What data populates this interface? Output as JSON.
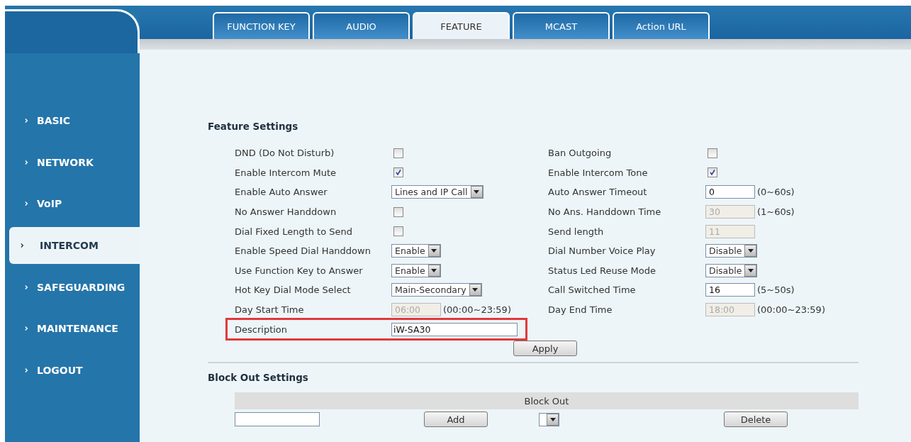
{
  "tabs": [
    {
      "label": "FUNCTION KEY",
      "selected": false
    },
    {
      "label": "AUDIO",
      "selected": false
    },
    {
      "label": "FEATURE",
      "selected": true
    },
    {
      "label": "MCAST",
      "selected": false
    },
    {
      "label": "Action URL",
      "selected": false
    }
  ],
  "sidebar": {
    "items": [
      {
        "label": "BASIC",
        "selected": false
      },
      {
        "label": "NETWORK",
        "selected": false
      },
      {
        "label": "VoIP",
        "selected": false
      },
      {
        "label": "INTERCOM",
        "selected": true
      },
      {
        "label": "SAFEGUARDING",
        "selected": false
      },
      {
        "label": "MAINTENANCE",
        "selected": false
      },
      {
        "label": "LOGOUT",
        "selected": false
      }
    ]
  },
  "feature_settings": {
    "title": "Feature Settings",
    "rows": [
      {
        "highlighted": false,
        "left": {
          "label": "DND (Do Not Disturb)",
          "kind": "checkbox",
          "checked": false
        },
        "right": {
          "label": "Ban Outgoing",
          "kind": "checkbox",
          "checked": false
        }
      },
      {
        "highlighted": false,
        "left": {
          "label": "Enable Intercom Mute",
          "kind": "checkbox",
          "checked": true
        },
        "right": {
          "label": "Enable Intercom Tone",
          "kind": "checkbox",
          "checked": true
        }
      },
      {
        "highlighted": false,
        "left": {
          "label": "Enable Auto Answer",
          "kind": "select",
          "value": "Lines and IP Call"
        },
        "right": {
          "label": "Auto Answer Timeout",
          "kind": "input",
          "value": "0",
          "disabled": false,
          "hint": "(0~60s)"
        }
      },
      {
        "highlighted": false,
        "left": {
          "label": "No Answer Handdown",
          "kind": "checkbox",
          "checked": false
        },
        "right": {
          "label": "No Ans. Handdown Time",
          "kind": "input",
          "value": "30",
          "disabled": true,
          "hint": "(1~60s)"
        }
      },
      {
        "highlighted": false,
        "left": {
          "label": "Dial Fixed Length to Send",
          "kind": "checkbox",
          "checked": false
        },
        "right": {
          "label": "Send length",
          "kind": "input",
          "value": "11",
          "disabled": true
        }
      },
      {
        "highlighted": false,
        "left": {
          "label": "Enable Speed Dial Handdown",
          "kind": "select",
          "value": "Enable"
        },
        "right": {
          "label": "Dial Number Voice Play",
          "kind": "select",
          "value": "Disable"
        }
      },
      {
        "highlighted": false,
        "left": {
          "label": "Use Function Key to Answer",
          "kind": "select",
          "value": "Enable"
        },
        "right": {
          "label": "Status Led Reuse Mode",
          "kind": "select",
          "value": "Disable"
        }
      },
      {
        "highlighted": false,
        "left": {
          "label": "Hot Key Dial Mode Select",
          "kind": "select",
          "value": "Main-Secondary"
        },
        "right": {
          "label": "Call Switched Time",
          "kind": "input",
          "value": "16",
          "disabled": false,
          "hint": "(5~50s)"
        }
      },
      {
        "highlighted": false,
        "left": {
          "label": "Day Start Time",
          "kind": "input",
          "value": "06:00",
          "disabled": true,
          "hint": "(00:00~23:59)"
        },
        "right": {
          "label": "Day End Time",
          "kind": "input",
          "value": "18:00",
          "disabled": true,
          "hint": "(00:00~23:59)"
        }
      },
      {
        "highlighted": true,
        "left": {
          "label": "Description",
          "kind": "wide_input",
          "value": "iW-SA30",
          "disabled": false
        }
      }
    ],
    "apply_button": "Apply"
  },
  "block_out_settings": {
    "title": "Block Out Settings",
    "table_header": "Block Out",
    "add_button": "Add",
    "delete_button": "Delete"
  }
}
